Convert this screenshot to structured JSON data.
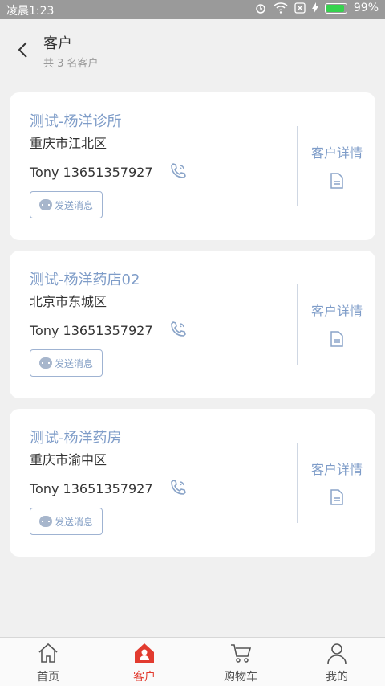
{
  "status_bar": {
    "time": "凌晨1:23",
    "battery": "99%"
  },
  "header": {
    "title": "客户",
    "subtitle": "共 3 名客户"
  },
  "customers": [
    {
      "name": "测试-杨洋诊所",
      "region": "重庆市江北区",
      "contact": "Tony 13651357927",
      "message_label": "发送消息",
      "detail_label": "客户详情"
    },
    {
      "name": "测试-杨洋药店02",
      "region": "北京市东城区",
      "contact": "Tony 13651357927",
      "message_label": "发送消息",
      "detail_label": "客户详情"
    },
    {
      "name": "测试-杨洋药房",
      "region": "重庆市渝中区",
      "contact": "Tony 13651357927",
      "message_label": "发送消息",
      "detail_label": "客户详情"
    }
  ],
  "tabbar": {
    "tabs": [
      {
        "label": "首页",
        "icon": "home-icon"
      },
      {
        "label": "客户",
        "icon": "customer-icon"
      },
      {
        "label": "购物车",
        "icon": "cart-icon"
      },
      {
        "label": "我的",
        "icon": "user-icon"
      }
    ],
    "active_index": 1
  },
  "colors": {
    "accent_blue": "#7e9cc8",
    "active_red": "#e23b2f",
    "battery_green": "#36d24e"
  }
}
